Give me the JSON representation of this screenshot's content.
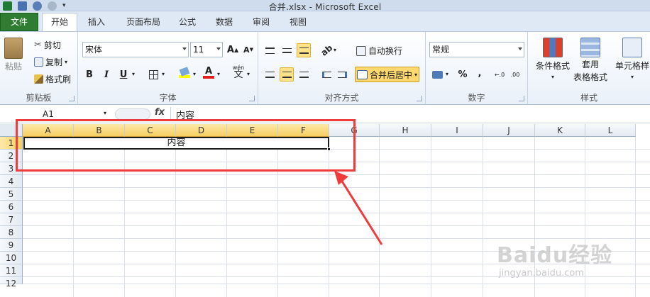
{
  "window": {
    "title": "合并.xlsx - Microsoft Excel"
  },
  "tabs": [
    "文件",
    "开始",
    "插入",
    "页面布局",
    "公式",
    "数据",
    "审阅",
    "视图"
  ],
  "clipboard": {
    "paste": "粘贴",
    "cut": "剪切",
    "copy": "复制",
    "format_painter": "格式刷",
    "label": "剪贴板"
  },
  "font": {
    "name": "宋体",
    "size": "11",
    "label": "字体",
    "bold": "B",
    "italic": "I",
    "underline": "U",
    "grow": "A",
    "shrink": "A",
    "color_letter": "A",
    "wen": "wén",
    "wen_char": "文"
  },
  "alignment": {
    "wrap": "自动换行",
    "merge": "合并后居中",
    "label": "对齐方式"
  },
  "number": {
    "format": "常规",
    "percent": "%",
    "comma": ",",
    "label": "数字"
  },
  "styles": {
    "conditional": "条件格式",
    "table_line1": "套用",
    "table_line2": "表格格式",
    "cell_styles": "单元格样",
    "label": "样式"
  },
  "formula_bar": {
    "name_box": "A1",
    "fx": "fx",
    "value": "内容"
  },
  "columns": [
    "A",
    "B",
    "C",
    "D",
    "E",
    "F",
    "G",
    "H",
    "I",
    "J",
    "K",
    "L"
  ],
  "rows": [
    "1",
    "2",
    "3",
    "4",
    "5",
    "6",
    "7",
    "8",
    "9",
    "10",
    "11",
    "12"
  ],
  "merged_cell": {
    "value": "内容"
  },
  "watermark": {
    "brand": "Baidu经验",
    "url": "jingyan.baidu.com"
  },
  "colors": {
    "file_tab": "#2e7d32",
    "annotation": "#ee3b3b",
    "selection": "#f7cf63"
  }
}
